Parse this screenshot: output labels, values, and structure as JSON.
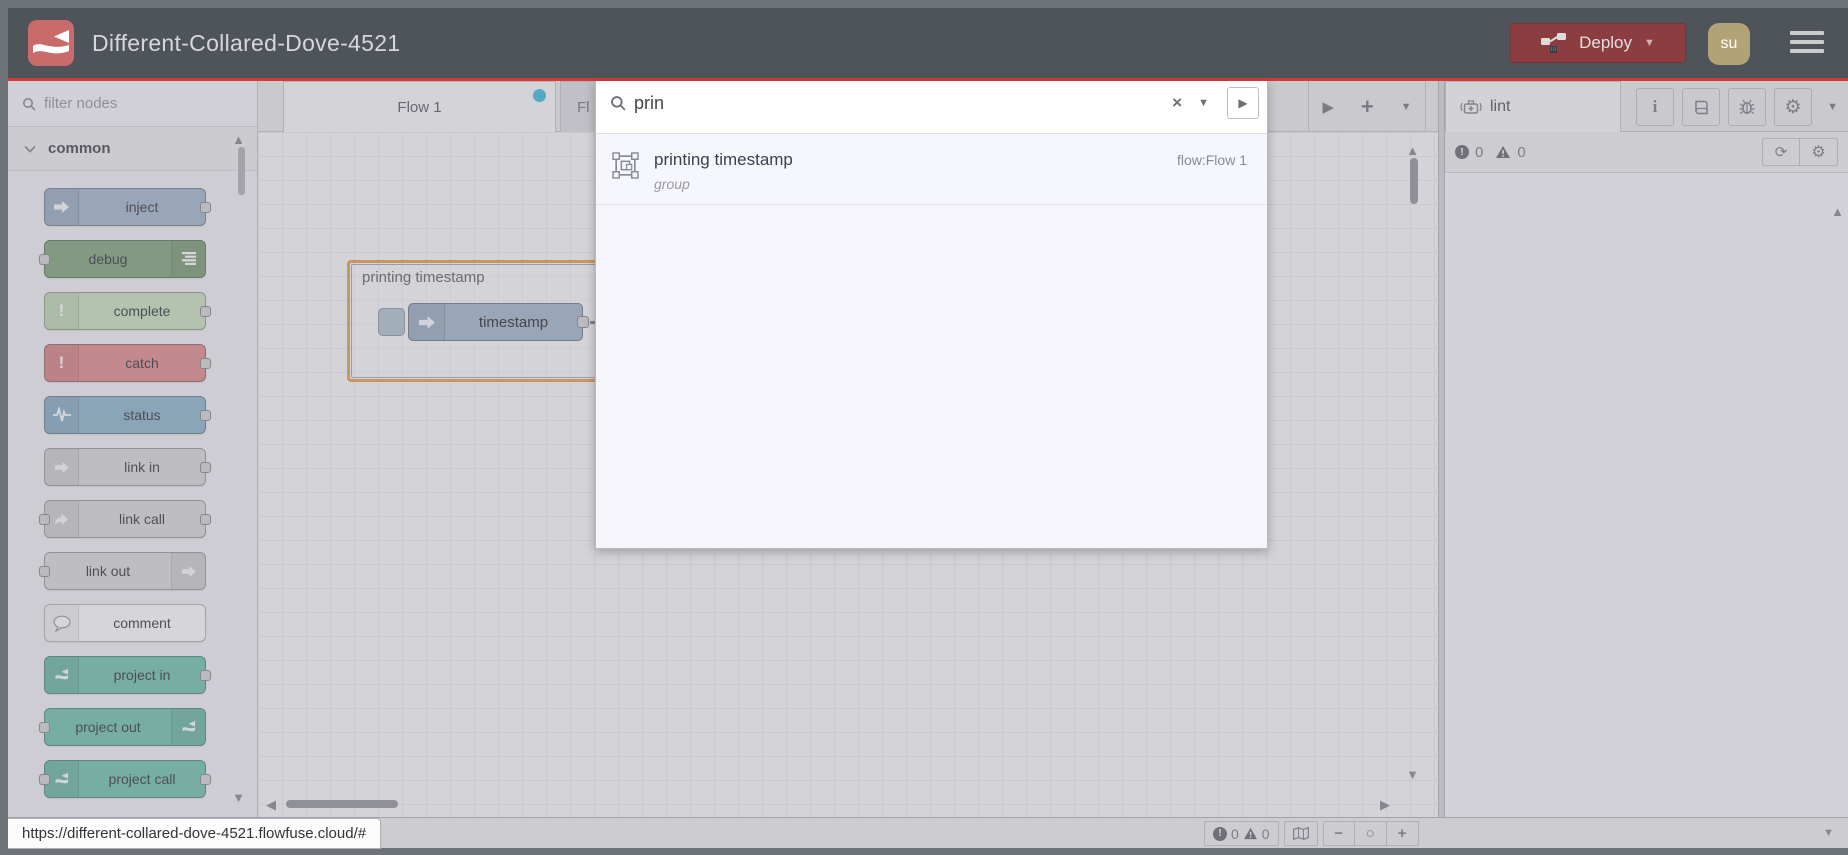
{
  "window": {
    "url_tooltip": "https://different-collared-dove-4521.flowfuse.cloud/#"
  },
  "header": {
    "title": "Different-Collared-Dove-4521",
    "deploy_label": "Deploy",
    "avatar_initials": "su"
  },
  "palette": {
    "filter_placeholder": "filter nodes",
    "category_label": "common",
    "nodes": [
      {
        "label": "inject",
        "color": "#a6bbcf"
      },
      {
        "label": "debug",
        "color": "#87a980"
      },
      {
        "label": "complete",
        "color": "#cde4c2"
      },
      {
        "label": "catch",
        "color": "#e49191"
      },
      {
        "label": "status",
        "color": "#94b9cf"
      },
      {
        "label": "link in",
        "color": "#dddddd"
      },
      {
        "label": "link call",
        "color": "#dddddd"
      },
      {
        "label": "link out",
        "color": "#dddddd"
      },
      {
        "label": "comment",
        "color": "#ffffff"
      },
      {
        "label": "project in",
        "color": "#76c6b2"
      },
      {
        "label": "project out",
        "color": "#76c6b2"
      },
      {
        "label": "project call",
        "color": "#76c6b2"
      }
    ]
  },
  "workspace": {
    "tabs": [
      {
        "label": "Flow 1"
      },
      {
        "label": "Fl"
      }
    ],
    "group_label": "printing timestamp",
    "inject_node_label": "timestamp"
  },
  "search": {
    "query": "prin",
    "results": [
      {
        "title": "printing timestamp",
        "subtitle": "group",
        "flow": "flow:Flow 1"
      }
    ]
  },
  "sidebar": {
    "tab_label": "lint",
    "errors": "0",
    "warnings": "0"
  },
  "canvas_footer": {
    "errors": "0",
    "warnings": "0"
  },
  "icons": {
    "close": "×",
    "caret_down": "▼",
    "caret_up": "▲",
    "arrow_right": "▶",
    "arrow_left": "◀",
    "plus": "+",
    "gear": "⚙",
    "refresh": "⟳",
    "info": "i",
    "zoom_minus": "−",
    "zoom_reset": "○",
    "zoom_plus": "+",
    "exclamation": "!"
  },
  "colors": {
    "header_bg": "#4f545a",
    "accent_line": "#d23b3b",
    "deploy_bg": "#8c3d3f",
    "avatar_bg": "#b2a276",
    "group_border": "#eda54e",
    "tab_dirty_dot": "#45bfe4"
  }
}
